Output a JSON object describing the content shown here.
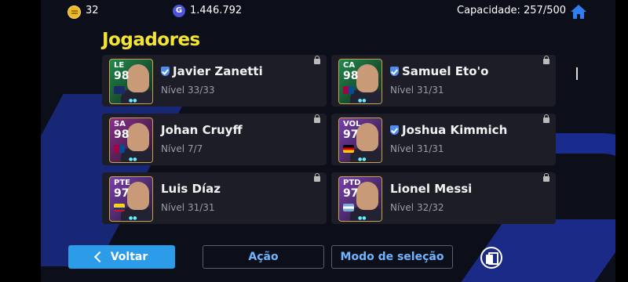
{
  "topbar": {
    "coins": "32",
    "gp": "1.446.792",
    "capacity": "Capacidade: 257/500",
    "coin_icon": "coin-icon",
    "gp_icon": "gp-icon",
    "gp_glyph": "G",
    "home_icon": "home-icon"
  },
  "page_title": "Jogadores",
  "players": [
    {
      "position": "LE",
      "rating": "98",
      "name": "Javier Zanetti",
      "verified": true,
      "level": "Nível 33/33",
      "card_color": "#1f8a4c"
    },
    {
      "position": "CA",
      "rating": "98",
      "name": "Samuel Eto'o",
      "verified": true,
      "level": "Nível 31/31",
      "card_color": "#1f8a4c"
    },
    {
      "position": "SA",
      "rating": "98",
      "name": "Johan Cruyff",
      "verified": false,
      "level": "Nível 7/7",
      "card_color": "#8a2f8f"
    },
    {
      "position": "VOL",
      "rating": "97",
      "name": "Joshua Kimmich",
      "verified": true,
      "level": "Nível 31/31",
      "card_color": "#7a3fb0"
    },
    {
      "position": "PTE",
      "rating": "97",
      "name": "Luis Díaz",
      "verified": false,
      "level": "Nível 31/31",
      "card_color": "#7a3fb0"
    },
    {
      "position": "PTD",
      "rating": "97",
      "name": "Lionel Messi",
      "verified": false,
      "level": "Nível 32/32",
      "card_color": "#7a3fb0"
    }
  ],
  "buttons": {
    "back": "Voltar",
    "action": "Ação",
    "selection_mode": "Modo de seleção",
    "copy_icon": "copy-icon"
  },
  "colors": {
    "title_yellow": "#f4e433",
    "back_button": "#2c9be8",
    "link_blue": "#6fb5ff"
  }
}
